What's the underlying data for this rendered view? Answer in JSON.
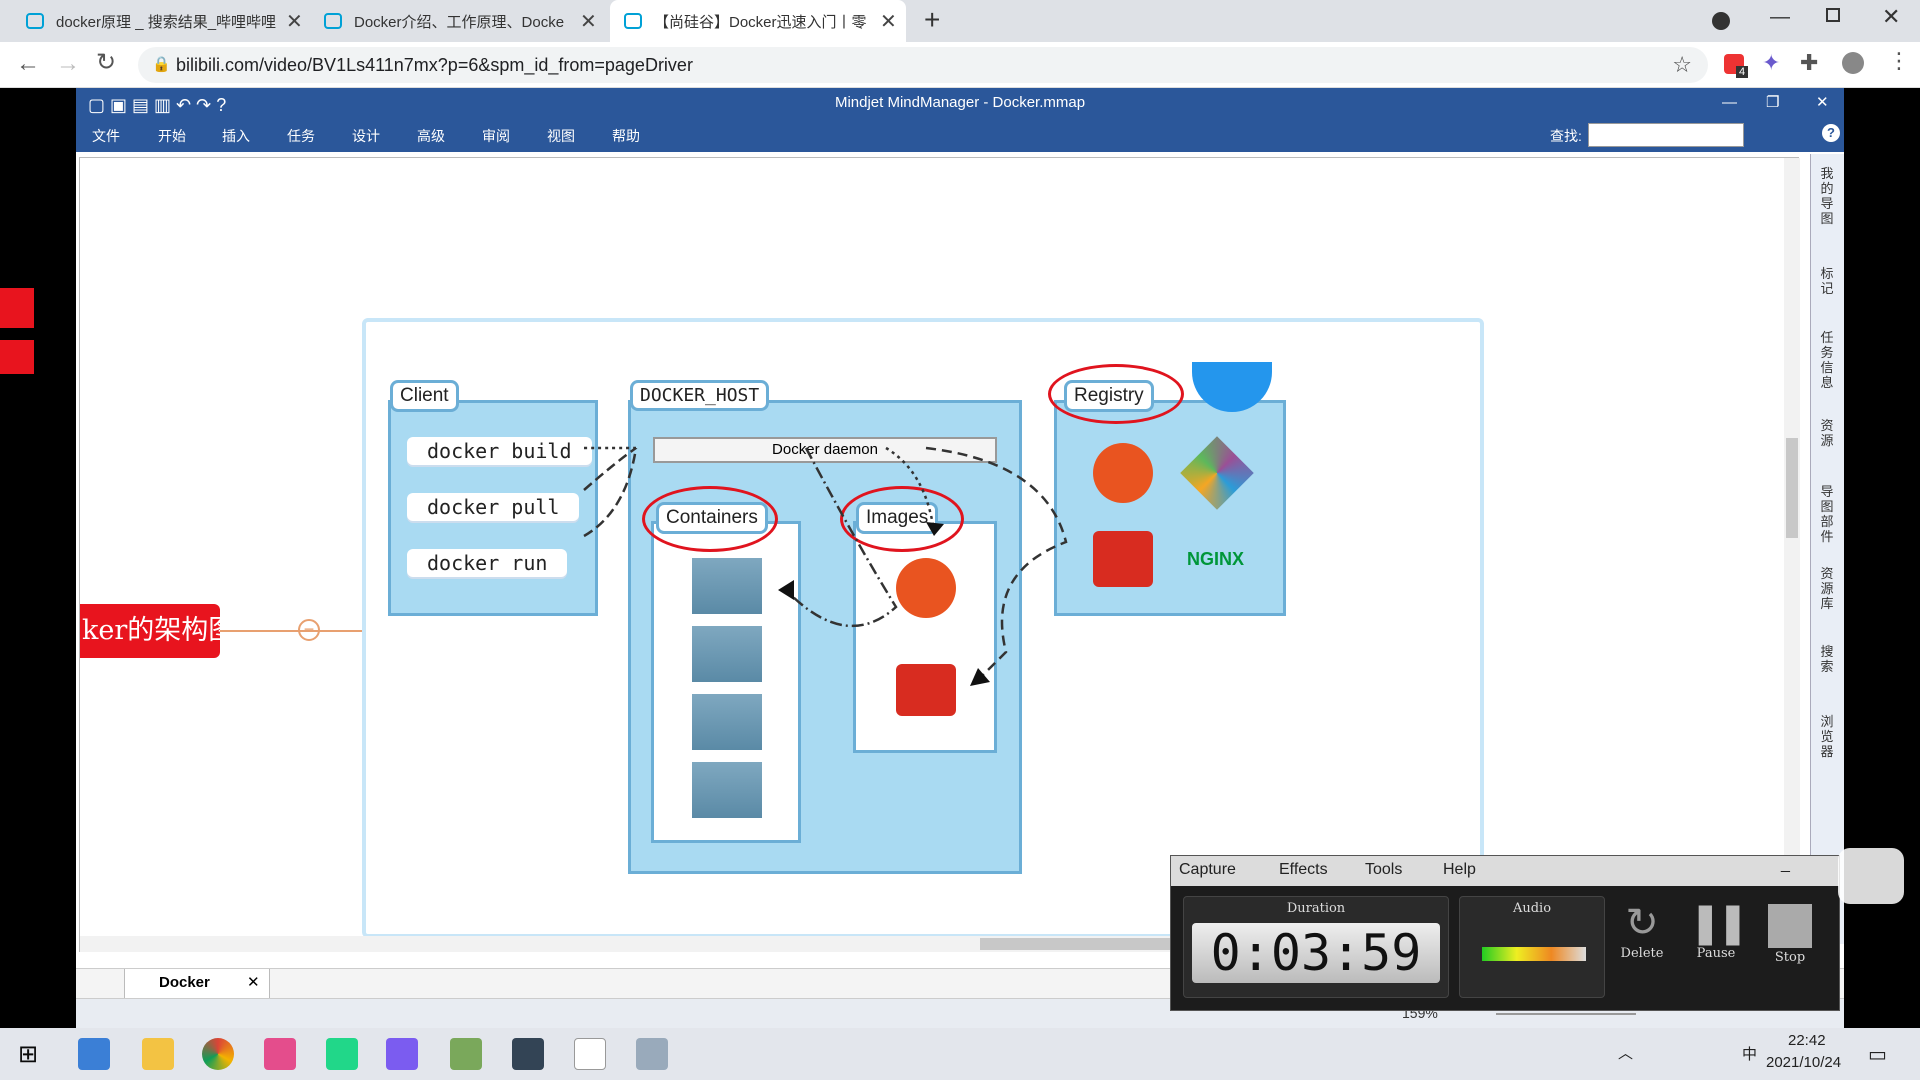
{
  "browser": {
    "tabs": [
      {
        "title": "docker原理 _ 搜索结果_哔哩哔哩",
        "active": false
      },
      {
        "title": "Docker介绍、工作原理、Docke",
        "active": false
      },
      {
        "title": "【尚硅谷】Docker迅速入门丨零",
        "active": true
      }
    ],
    "new_tab": "+",
    "url": "bilibili.com/video/BV1Ls411n7mx?p=6&spm_id_from=pageDriver",
    "ext_badge": "4"
  },
  "app": {
    "title": "Mindjet MindManager - Docker.mmap",
    "menu": [
      "文件",
      "开始",
      "插入",
      "任务",
      "设计",
      "高级",
      "审阅",
      "视图",
      "帮助"
    ],
    "search_label": "查找:",
    "right_panels": [
      "我的导图",
      "标记",
      "任务信息",
      "资源",
      "导图部件",
      "资源库",
      "搜索",
      "浏览器"
    ],
    "doc_tab": "Docker",
    "zoom": "159%"
  },
  "diagram": {
    "central_topic": "ker的架构图",
    "client": {
      "title": "Client",
      "commands": [
        "docker build",
        "docker pull",
        "docker run"
      ]
    },
    "host": {
      "title": "DOCKER_HOST",
      "daemon": "Docker daemon",
      "containers": "Containers",
      "images": "Images"
    },
    "registry": {
      "title": "Registry",
      "nginx": "NGINX"
    }
  },
  "recorder": {
    "menu": [
      "Capture",
      "Effects",
      "Tools",
      "Help"
    ],
    "duration_label": "Duration",
    "duration": "0:03:59",
    "audio_label": "Audio",
    "buttons": [
      "Delete",
      "Pause",
      "Stop"
    ]
  },
  "taskbar": {
    "time": "22:42",
    "date": "2021/10/24",
    "ime": "中"
  },
  "colors": {
    "accent": "#2b579a",
    "box_fill": "#a9daf2",
    "box_border": "#6baed6",
    "highlight": "#e0141e"
  }
}
